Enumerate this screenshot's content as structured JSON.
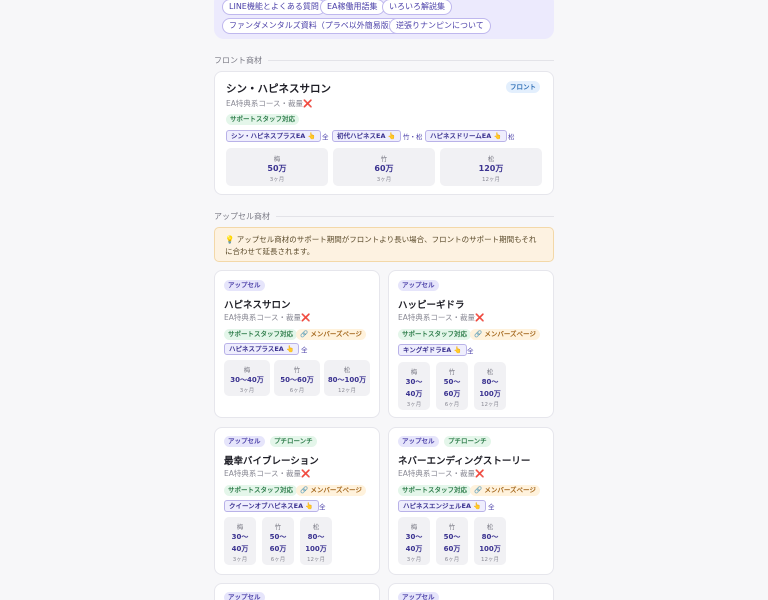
{
  "top_chips": [
    "LINE機能とよくある質問",
    "EA稼働用語集",
    "いろいろ解説集",
    "ファンダメンタルズ資料（プラベ以外簡易版）",
    "逆張りナンピンについて"
  ],
  "section_front": "フロント商材",
  "section_upsell": "アップセル商材",
  "front": {
    "title": "シン・ハピネスサロン",
    "sub": "EA特典系コース・裁量",
    "badge": "フロント",
    "support": "サポートスタッフ対応",
    "eas": [
      {
        "name": "シン・ハピネスプラスEA",
        "note": "全"
      },
      {
        "name": "初代ハピネスEA",
        "note": "竹・松"
      },
      {
        "name": "ハピネスドリームEA",
        "note": "松"
      }
    ],
    "plans": [
      {
        "name": "梅",
        "price": "50万",
        "period": "3ヶ月"
      },
      {
        "name": "竹",
        "price": "60万",
        "period": "3ヶ月"
      },
      {
        "name": "松",
        "price": "120万",
        "period": "12ヶ月"
      }
    ]
  },
  "notice": "💡 アップセル商材のサポート期間がフロントより長い場合、フロントのサポート期間もそれに合わせて延長されます。",
  "labels": {
    "upsell": "アップセル",
    "petit": "プチローンチ",
    "support": "サポートスタッフ対応",
    "member": "🔗 メンバーズページ",
    "sub": "EA特典系コース・裁量",
    "x": "❌"
  },
  "upsells": [
    {
      "title": "ハピネスサロン",
      "ea": "ハピネスプラスEA",
      "note": "全",
      "petit": false,
      "plans": [
        {
          "name": "梅",
          "price": "30〜40万",
          "period": "3ヶ月"
        },
        {
          "name": "竹",
          "price": "50〜60万",
          "period": "6ヶ月"
        },
        {
          "name": "松",
          "price": "80〜100万",
          "period": "12ヶ月"
        }
      ]
    },
    {
      "title": "ハッピーギドラ",
      "ea": "キングギドラEA",
      "note": "全",
      "petit": false,
      "plans": [
        {
          "name": "梅",
          "price": "30〜40万",
          "period": "3ヶ月"
        },
        {
          "name": "竹",
          "price": "50〜60万",
          "period": "6ヶ月"
        },
        {
          "name": "松",
          "price": "80〜100万",
          "period": "12ヶ月"
        }
      ]
    },
    {
      "title": "最幸バイブレーション",
      "ea": "クイーンオブハピネスEA",
      "note": "全",
      "petit": true,
      "plans": [
        {
          "name": "梅",
          "price": "30〜40万",
          "period": "3ヶ月"
        },
        {
          "name": "竹",
          "price": "50〜60万",
          "period": "6ヶ月"
        },
        {
          "name": "松",
          "price": "80〜100万",
          "period": "12ヶ月"
        }
      ]
    },
    {
      "title": "ネバーエンディングストーリー",
      "ea": "ハピネスエンジェルEA",
      "note": "全",
      "petit": true,
      "plans": [
        {
          "name": "梅",
          "price": "30〜40万",
          "period": "3ヶ月"
        },
        {
          "name": "竹",
          "price": "50〜60万",
          "period": "6ヶ月"
        },
        {
          "name": "松",
          "price": "80〜100万",
          "period": "12ヶ月"
        }
      ]
    }
  ],
  "bottom_badges": [
    "アップセル",
    "アップセル"
  ]
}
